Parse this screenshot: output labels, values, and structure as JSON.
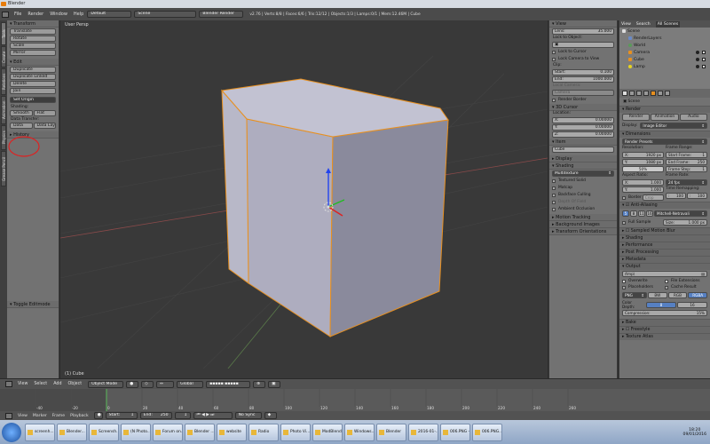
{
  "window": {
    "title": "Blender"
  },
  "info_header": {
    "menus": [
      "File",
      "Render",
      "Window",
      "Help"
    ],
    "layout": "Default",
    "scene": "Scene",
    "engine": "Blender Render",
    "stats": "v2.76 | Verts:8/8 | Faces:6/6 | Tris:12/12 | Objects:1/3 | Lamps:0/1 | Mem:12.46M | Cube"
  },
  "left_tabs": [
    "Tools",
    "Create",
    "Relations",
    "Animation",
    "Physics",
    "Grease Pencil"
  ],
  "tool_shelf": {
    "transform_header": "Transform",
    "transform_buttons": [
      "Translate",
      "Rotate",
      "Scale",
      "Mirror"
    ],
    "edit_header": "Edit",
    "edit_buttons": [
      "Duplicate",
      "Duplicate Linked",
      "Delete",
      "Join"
    ],
    "set_origin": "Set Origin",
    "shading_label": "Shading:",
    "smooth": "Smooth",
    "flat": "Flat",
    "data_transfer_label": "Data Transfer:",
    "data": "Data",
    "data_layout": "Data Layo",
    "history_header": "History",
    "toggle_editmode": "Toggle Editmode"
  },
  "viewport": {
    "label": "User Persp",
    "object_label": "(1) Cube"
  },
  "view_props": {
    "view_header": "View",
    "lens_label": "Lens:",
    "lens_value": "35.000",
    "lock_to_object": "Lock to Object:",
    "lock_to_cursor": "Lock to Cursor",
    "lock_camera_to_view": "Lock Camera to View",
    "clip_label": "Clip:",
    "clip_start_label": "Start:",
    "clip_start_value": "0.100",
    "clip_end_label": "End:",
    "clip_end_value": "1000.000",
    "local_camera": "Local Camera:",
    "camera_field": "Camera",
    "render_border": "Render Border",
    "cursor_header": "3D Cursor",
    "location_label": "Location:",
    "cursor": [
      {
        "axis": "X:",
        "value": "0.00000"
      },
      {
        "axis": "Y:",
        "value": "0.00000"
      },
      {
        "axis": "Z:",
        "value": "0.00000"
      }
    ],
    "item_header": "Item",
    "item_name": "Cube",
    "display_header": "Display",
    "shading_header": "Shading",
    "shading_mode": "Multitexture",
    "shading_opts": [
      "Textured Solid",
      "Matcap",
      "Backface Culling",
      "Depth Of Field",
      "Ambient Occlusion"
    ],
    "motion_tracking": "Motion Tracking",
    "background_images": "Background Images",
    "transform_orientations": "Transform Orientations"
  },
  "outliner": {
    "tabs": [
      "View",
      "Search",
      "All Scenes"
    ],
    "items": [
      "Scene",
      "RenderLayers",
      "World",
      "Camera",
      "Cube",
      "Lamp"
    ]
  },
  "render_props": {
    "scene_label": "Scene",
    "render_header": "Render",
    "render_btns": [
      "Render",
      "Animation",
      "Audio"
    ],
    "display_label": "Display:",
    "display_value": "Image Editor",
    "dimensions_header": "Dimensions",
    "render_presets": "Render Presets",
    "resolution_label": "Resolution:",
    "res_x": "1920 px",
    "res_y": "1080 px",
    "res_pct": "50%",
    "frame_range_label": "Frame Range:",
    "start_frame": "1",
    "end_frame": "250",
    "frame_step": "1",
    "aspect_label": "Aspect Ratio:",
    "aspect_x": "1.000",
    "aspect_y": "1.000",
    "frame_rate_label": "Frame Rate:",
    "frame_rate": "24 fps",
    "time_remap_label": "Time Remapping:",
    "remap_old": "100",
    "remap_new": "100",
    "border": "Border",
    "crop": "Crop",
    "aa_header": "Anti-Aliasing",
    "aa_samples": [
      "5",
      "8",
      "11",
      "16"
    ],
    "aa_filter": "Mitchell-Netravali",
    "full_sample": "Full Sample",
    "aa_size": "1.000 px",
    "collapsed": [
      "Sampled Motion Blur",
      "Shading",
      "Performance",
      "Post Processing",
      "Metadata"
    ],
    "output_header": "Output",
    "output_path": "/tmp\\",
    "overwrite": "Overwrite",
    "file_extensions": "File Extensions",
    "placeholders": "Placeholders",
    "cache_result": "Cache Result",
    "format": "PNG",
    "color_modes": [
      "BW",
      "RGB",
      "RGBA"
    ],
    "color_depth_label": "Color Depth:",
    "color_depths": [
      "8",
      "16"
    ],
    "compression_label": "Compression:",
    "compression_value": "15%",
    "collapsed2": [
      "Bake",
      "Freestyle",
      "Texture Atlas"
    ]
  },
  "view3d_header": {
    "menus": [
      "View",
      "Select",
      "Add",
      "Object"
    ],
    "mode": "Object Mode",
    "orientation": "Global"
  },
  "timeline": {
    "ticks": [
      "-40",
      "-20",
      "0",
      "20",
      "40",
      "60",
      "80",
      "100",
      "120",
      "140",
      "160",
      "180",
      "200",
      "220",
      "240",
      "260"
    ],
    "menus": [
      "View",
      "Marker",
      "Frame",
      "Playback"
    ],
    "start_label": "Start:",
    "start": "1",
    "end_label": "End:",
    "end": "250",
    "current": "1",
    "sync": "No Sync"
  },
  "taskbar": {
    "buttons": [
      "screenh...",
      "Blender...",
      "Screensh...",
      "(N Photo...",
      "Forum on...",
      "Blender ...",
      "website",
      "Radio",
      "Photo Vi...",
      "ModBlend...",
      "Windows...",
      "Blender",
      "2016-01-...",
      "006.PNG -...",
      "006.PNG..."
    ],
    "time": "18:20",
    "date": "09/01/2016"
  },
  "colors": {
    "accent_orange": "#e87d0d",
    "selected_blue": "#5680c2",
    "annotation_red": "#dd2222"
  }
}
